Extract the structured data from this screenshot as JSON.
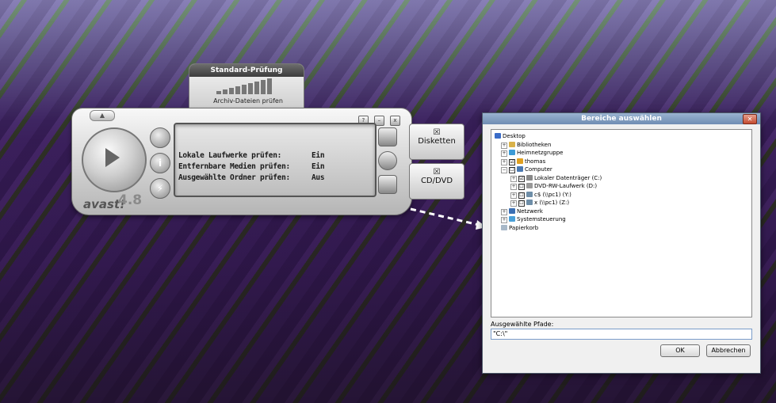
{
  "profile": {
    "title": "Standard-Prüfung",
    "caption": "Archiv-Dateien prüfen"
  },
  "avast": {
    "lcd_rows": [
      {
        "label": "Lokale Laufwerke prüfen:",
        "value": "Ein"
      },
      {
        "label": "Entfernbare Medien prüfen:",
        "value": "Ein"
      },
      {
        "label": "Ausgewählte Ordner prüfen:",
        "value": "Aus"
      }
    ],
    "logo": "avast!",
    "version": "4.8",
    "window_buttons": [
      "?",
      "–",
      "x"
    ],
    "drives": [
      {
        "label": "Disketten",
        "checked": "☒"
      },
      {
        "label": "CD/DVD",
        "checked": "☒"
      }
    ],
    "icons": {
      "play": "play-icon",
      "info": "info-icon",
      "lightning": "lightning-icon"
    }
  },
  "dialog": {
    "title": "Bereiche auswählen",
    "close": "✕",
    "tree": [
      {
        "label": "Desktop",
        "exp": "",
        "chk": "",
        "icon_color": "#3a6cc8"
      },
      {
        "label": "Bibliotheken",
        "exp": "+",
        "chk": "",
        "icon_color": "#d9b24a"
      },
      {
        "label": "Heimnetzgruppe",
        "exp": "+",
        "chk": "",
        "icon_color": "#3d9bd6"
      },
      {
        "label": "thomas",
        "exp": "+",
        "chk": "☑",
        "icon_color": "#e0a020"
      },
      {
        "label": "Computer",
        "exp": "−",
        "chk": "☐",
        "icon_color": "#4a78b0"
      },
      {
        "label": "Lokaler Datenträger (C:)",
        "exp": "+",
        "chk": "☑",
        "icon_color": "#888888"
      },
      {
        "label": "DVD-RW-Laufwerk (D:)",
        "exp": "+",
        "chk": "☐",
        "icon_color": "#999999"
      },
      {
        "label": "c$ (\\\\pc1) (Y:)",
        "exp": "+",
        "chk": "☐",
        "icon_color": "#6e8ea8"
      },
      {
        "label": "x (\\\\pc1) (Z:)",
        "exp": "+",
        "chk": "☐",
        "icon_color": "#6e8ea8"
      },
      {
        "label": "Netzwerk",
        "exp": "+",
        "chk": "",
        "icon_color": "#3b6fb3"
      },
      {
        "label": "Systemsteuerung",
        "exp": "+",
        "chk": "",
        "icon_color": "#4aa0d8"
      },
      {
        "label": "Papierkorb",
        "exp": "",
        "chk": "",
        "icon_color": "#a8b8c8"
      }
    ],
    "paths_label": "Ausgewählte Pfade:",
    "paths_value": "\"C:\\\"",
    "ok": "OK",
    "cancel": "Abbrechen"
  }
}
